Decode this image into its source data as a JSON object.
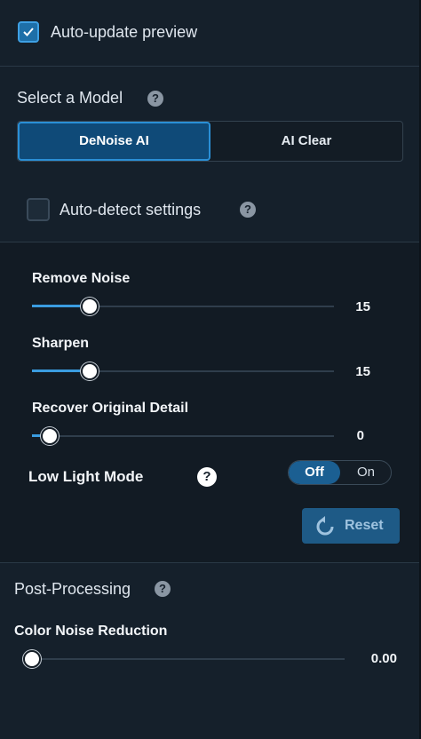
{
  "top": {
    "auto_update_label": "Auto-update preview",
    "auto_update_checked": true
  },
  "model": {
    "heading": "Select a Model",
    "options": [
      "DeNoise AI",
      "AI Clear"
    ],
    "selected": "DeNoise AI",
    "auto_detect_label": "Auto-detect settings",
    "auto_detect_checked": false
  },
  "sliders": [
    {
      "label": "Remove Noise",
      "value": "15",
      "fraction": 0.19
    },
    {
      "label": "Sharpen",
      "value": "15",
      "fraction": 0.19
    },
    {
      "label": "Recover Original Detail",
      "value": "0",
      "fraction": 0.06
    }
  ],
  "low_light": {
    "label": "Low Light Mode",
    "options": [
      "Off",
      "On"
    ],
    "selected": "Off"
  },
  "reset_label": "Reset",
  "post": {
    "heading": "Post-Processing",
    "slider": {
      "label": "Color Noise Reduction",
      "value": "0.00",
      "fraction": 0.0
    }
  },
  "icons": {
    "help": "help-icon",
    "check": "checkmark-icon",
    "reset": "refresh-icon"
  },
  "colors": {
    "accent": "#3a9ce0",
    "selected_bg": "#0f4a78",
    "background": "#15202b"
  }
}
